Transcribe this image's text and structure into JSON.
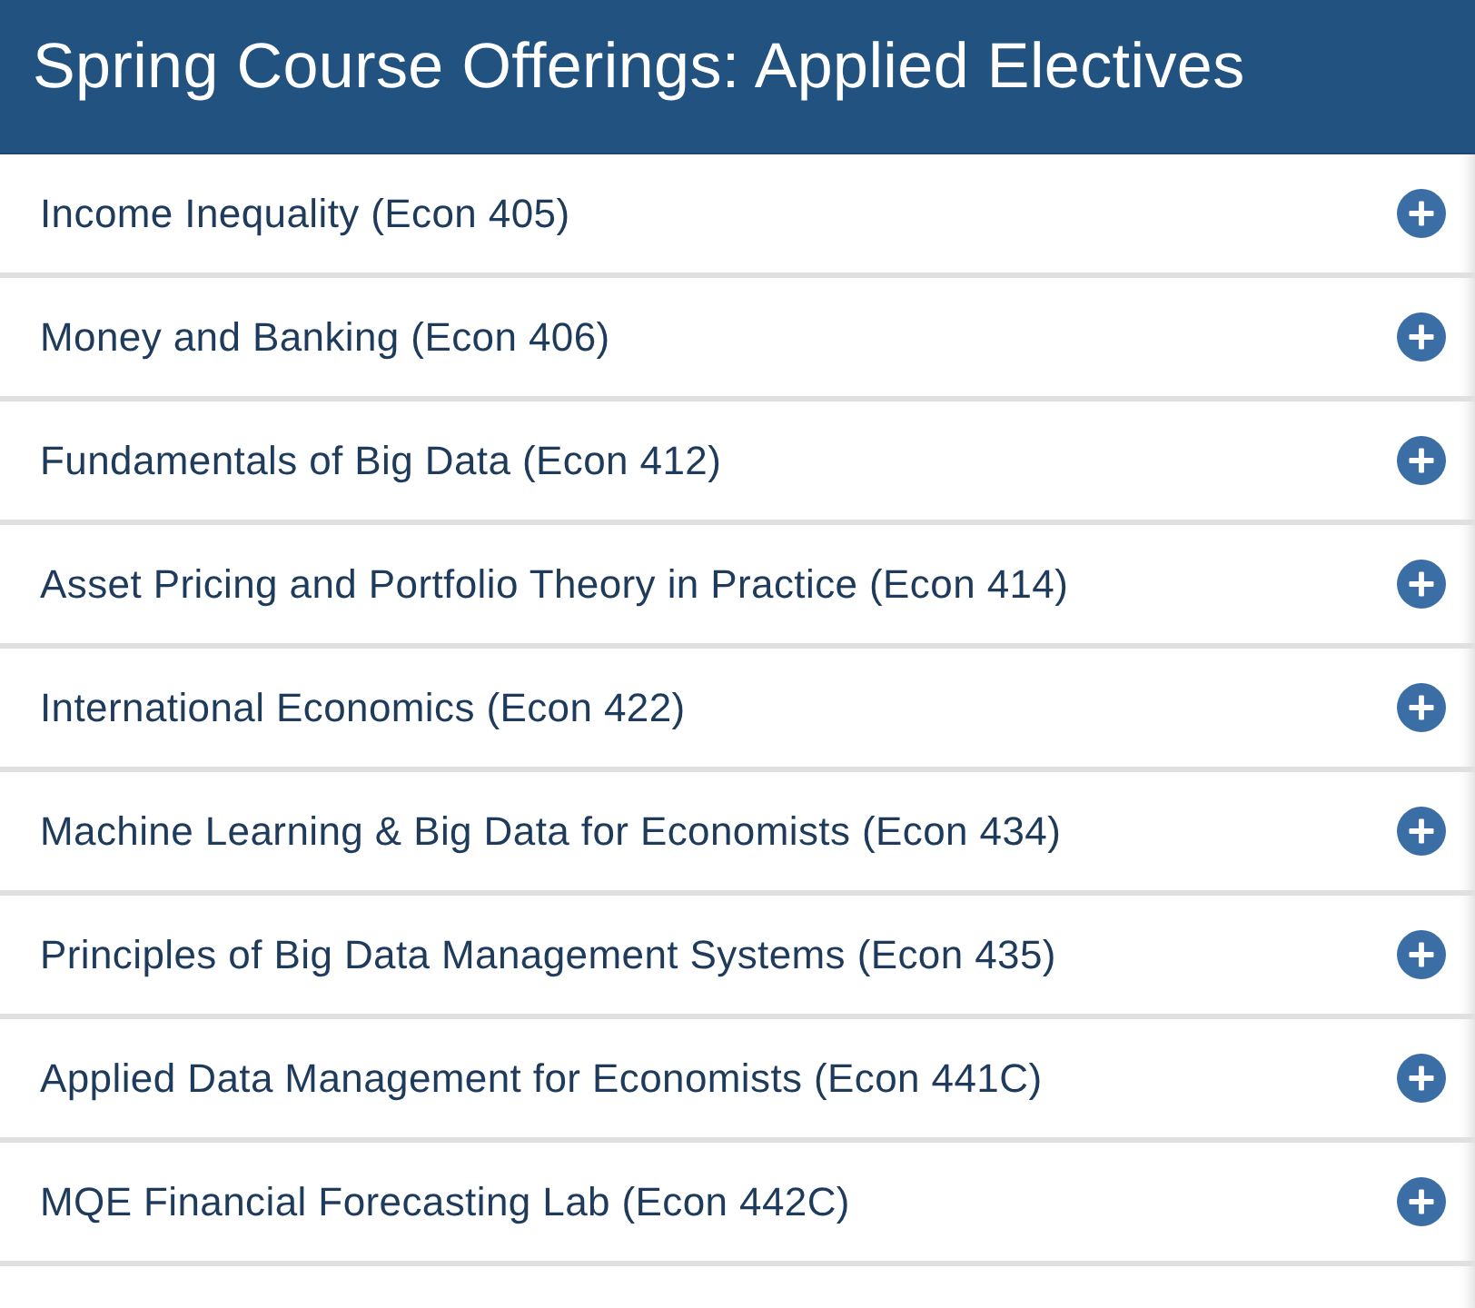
{
  "header": {
    "title": "Spring Course Offerings: Applied Electives"
  },
  "items": [
    {
      "label": "Income Inequality (Econ 405)",
      "expanded": false
    },
    {
      "label": "Money and Banking (Econ 406)",
      "expanded": false
    },
    {
      "label": "Fundamentals of Big Data (Econ 412)",
      "expanded": false
    },
    {
      "label": "Asset Pricing and Portfolio Theory in Practice (Econ 414)",
      "expanded": false
    },
    {
      "label": "International Economics (Econ 422)",
      "expanded": false
    },
    {
      "label": "Machine Learning & Big Data for Economists (Econ 434)",
      "expanded": false
    },
    {
      "label": "Principles of Big Data Management Systems (Econ 435)",
      "expanded": false
    },
    {
      "label": "Applied Data Management for Economists (Econ 441C)",
      "expanded": false
    },
    {
      "label": "MQE Financial Forecasting Lab (Econ 442C)",
      "expanded": false
    }
  ]
}
